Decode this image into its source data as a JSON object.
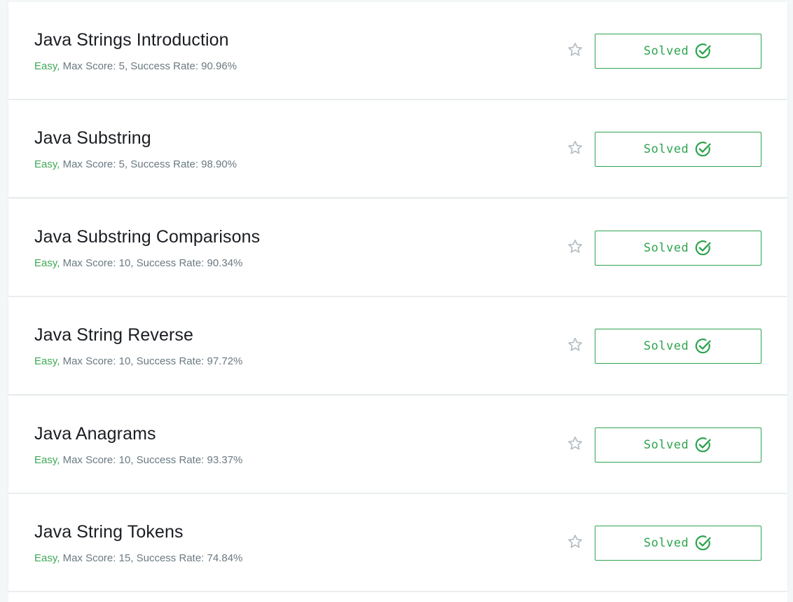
{
  "challenges": [
    {
      "title": "Java Strings Introduction",
      "difficulty": "Easy,",
      "stats": " Max Score: 5, Success Rate: 90.96%",
      "status": "Solved"
    },
    {
      "title": "Java Substring",
      "difficulty": "Easy,",
      "stats": " Max Score: 5, Success Rate: 98.90%",
      "status": "Solved"
    },
    {
      "title": "Java Substring Comparisons",
      "difficulty": "Easy,",
      "stats": " Max Score: 10, Success Rate: 90.34%",
      "status": "Solved"
    },
    {
      "title": "Java String Reverse",
      "difficulty": "Easy,",
      "stats": " Max Score: 10, Success Rate: 97.72%",
      "status": "Solved"
    },
    {
      "title": "Java Anagrams",
      "difficulty": "Easy,",
      "stats": " Max Score: 10, Success Rate: 93.37%",
      "status": "Solved"
    },
    {
      "title": "Java String Tokens",
      "difficulty": "Easy,",
      "stats": " Max Score: 15, Success Rate: 74.84%",
      "status": "Solved"
    }
  ],
  "icons": {
    "bookmark": "star-outline-icon",
    "status": "check-circle-icon"
  },
  "colors": {
    "accent": "#2ea44f",
    "difficulty_easy": "#3ea954",
    "muted": "#6a7a82",
    "star": "#b7c0c6"
  }
}
